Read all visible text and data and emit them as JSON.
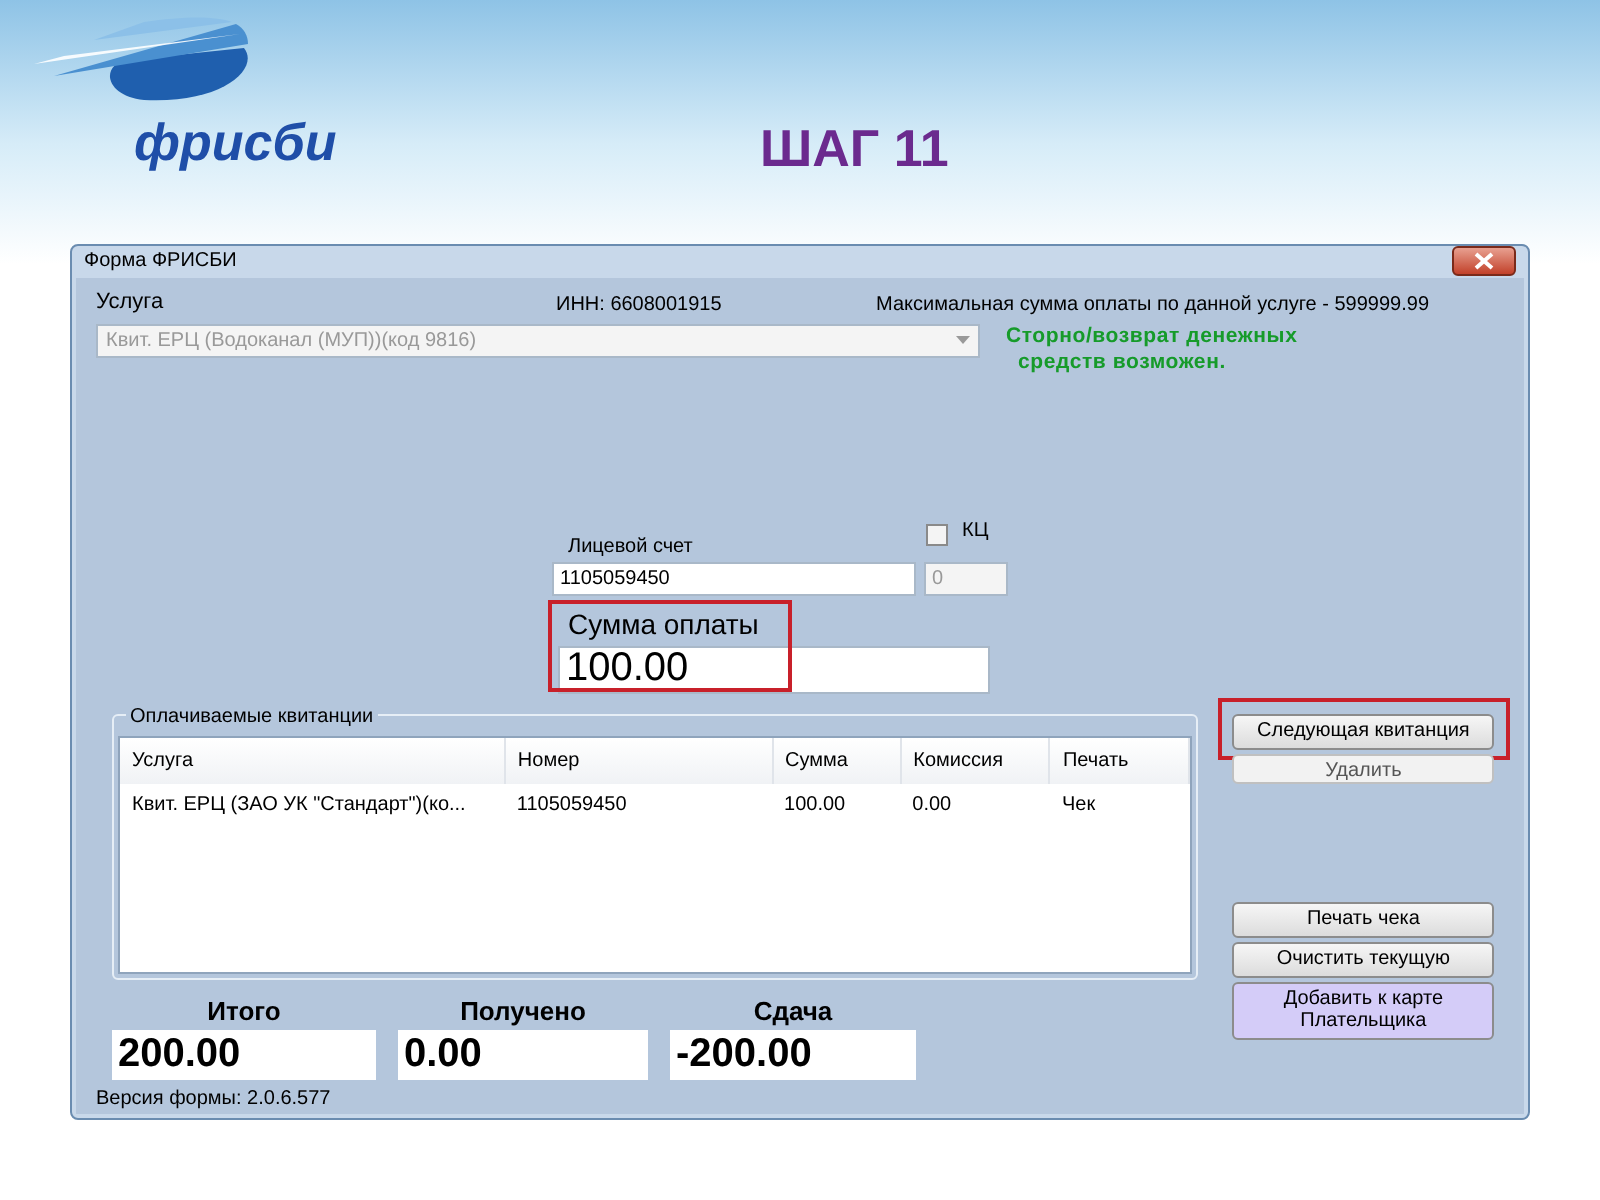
{
  "slide": {
    "logo_text": "фрисби",
    "title": "ШАГ 11"
  },
  "window": {
    "title": "Форма ФРИСБИ"
  },
  "service": {
    "label": "Услуга",
    "inn": "ИНН: 6608001915",
    "max_sum": "Максимальная сумма оплаты по данной услуге - 599999.99",
    "combo": {
      "value": "Квит. ЕРЦ (Водоканал (МУП))(код 9816)",
      "disabled": true
    },
    "refund_note": [
      "Сторно/возврат денежных",
      "средств возможен."
    ]
  },
  "account": {
    "label": "Лицевой счет",
    "value": "1105059450"
  },
  "kc": {
    "label": "КЦ",
    "checked": false,
    "value": "0",
    "disabled": true
  },
  "payment": {
    "label": "Сумма оплаты",
    "value": "100.00",
    "highlighted": true
  },
  "receipts": {
    "title": "Оплачиваемые квитанции",
    "columns": [
      "Услуга",
      "Номер",
      "Сумма",
      "Комиссия",
      "Печать"
    ],
    "rows": [
      [
        "Квит. ЕРЦ (ЗАО УК \"Стандарт\")(ко...",
        "1105059450",
        "100.00",
        "0.00",
        "Чек"
      ]
    ]
  },
  "top_buttons": [
    {
      "label": "Следующая квитанция",
      "highlighted": true,
      "disabled": false
    },
    {
      "label": "Удалить",
      "highlighted": false,
      "disabled": true
    }
  ],
  "bottom_buttons": [
    {
      "label": "Печать чека",
      "kind": "plain"
    },
    {
      "label": "Очистить текущую",
      "kind": "plain"
    },
    {
      "label": "Добавить к карте Плательщика",
      "kind": "accent"
    }
  ],
  "totals": [
    {
      "label": "Итого",
      "value": "200.00"
    },
    {
      "label": "Получено",
      "value": "0.00"
    },
    {
      "label": "Сдача",
      "value": "-200.00"
    }
  ],
  "version": "Версия формы: 2.0.6.577"
}
